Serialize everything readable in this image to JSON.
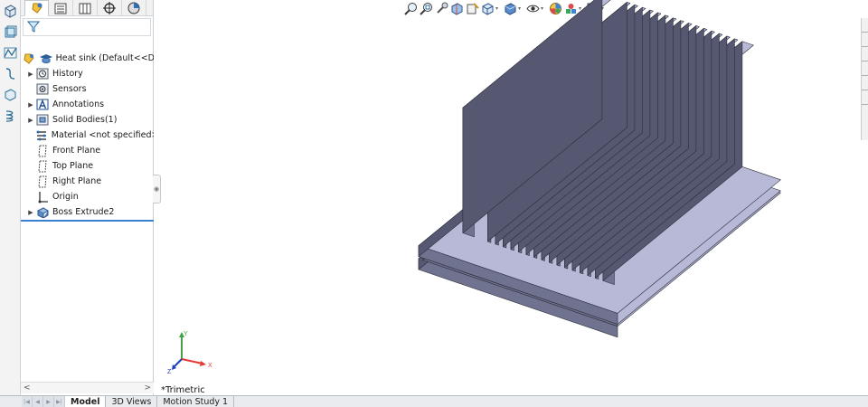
{
  "feature_tree": {
    "filter_icon": "funnel-icon",
    "part_name": "Heat sink  (Default<<Def",
    "items": [
      {
        "label": "History",
        "icon": "history-icon",
        "expandable": true
      },
      {
        "label": "Sensors",
        "icon": "sensor-icon",
        "expandable": false
      },
      {
        "label": "Annotations",
        "icon": "annotation-icon",
        "expandable": true
      },
      {
        "label": "Solid Bodies(1)",
        "icon": "solid-bodies-icon",
        "expandable": true
      },
      {
        "label": "Material <not specified>",
        "icon": "material-icon",
        "expandable": false
      },
      {
        "label": "Front Plane",
        "icon": "plane-icon",
        "expandable": false
      },
      {
        "label": "Top Plane",
        "icon": "plane-icon",
        "expandable": false
      },
      {
        "label": "Right Plane",
        "icon": "plane-icon",
        "expandable": false
      },
      {
        "label": "Origin",
        "icon": "origin-icon",
        "expandable": false
      },
      {
        "label": "Boss  Extrude2",
        "icon": "extrude-icon",
        "expandable": true
      }
    ]
  },
  "scrollbar": {
    "left_arrow": "<",
    "right_arrow": ">"
  },
  "bottom_tabs": {
    "model": "Model",
    "views3d": "3D Views",
    "motion": "Motion Study 1"
  },
  "viewport": {
    "view_name": "*Trimetric",
    "triad": {
      "x": "X",
      "y": "Y",
      "z": "Z"
    }
  },
  "colors": {
    "selection": "#3b7fd1",
    "body_top": "#b7b9d6",
    "body_side": "#6f738f",
    "body_dark": "#555870",
    "triad_x": "#e53935",
    "triad_y": "#43a047",
    "triad_z": "#1e3fbf"
  }
}
